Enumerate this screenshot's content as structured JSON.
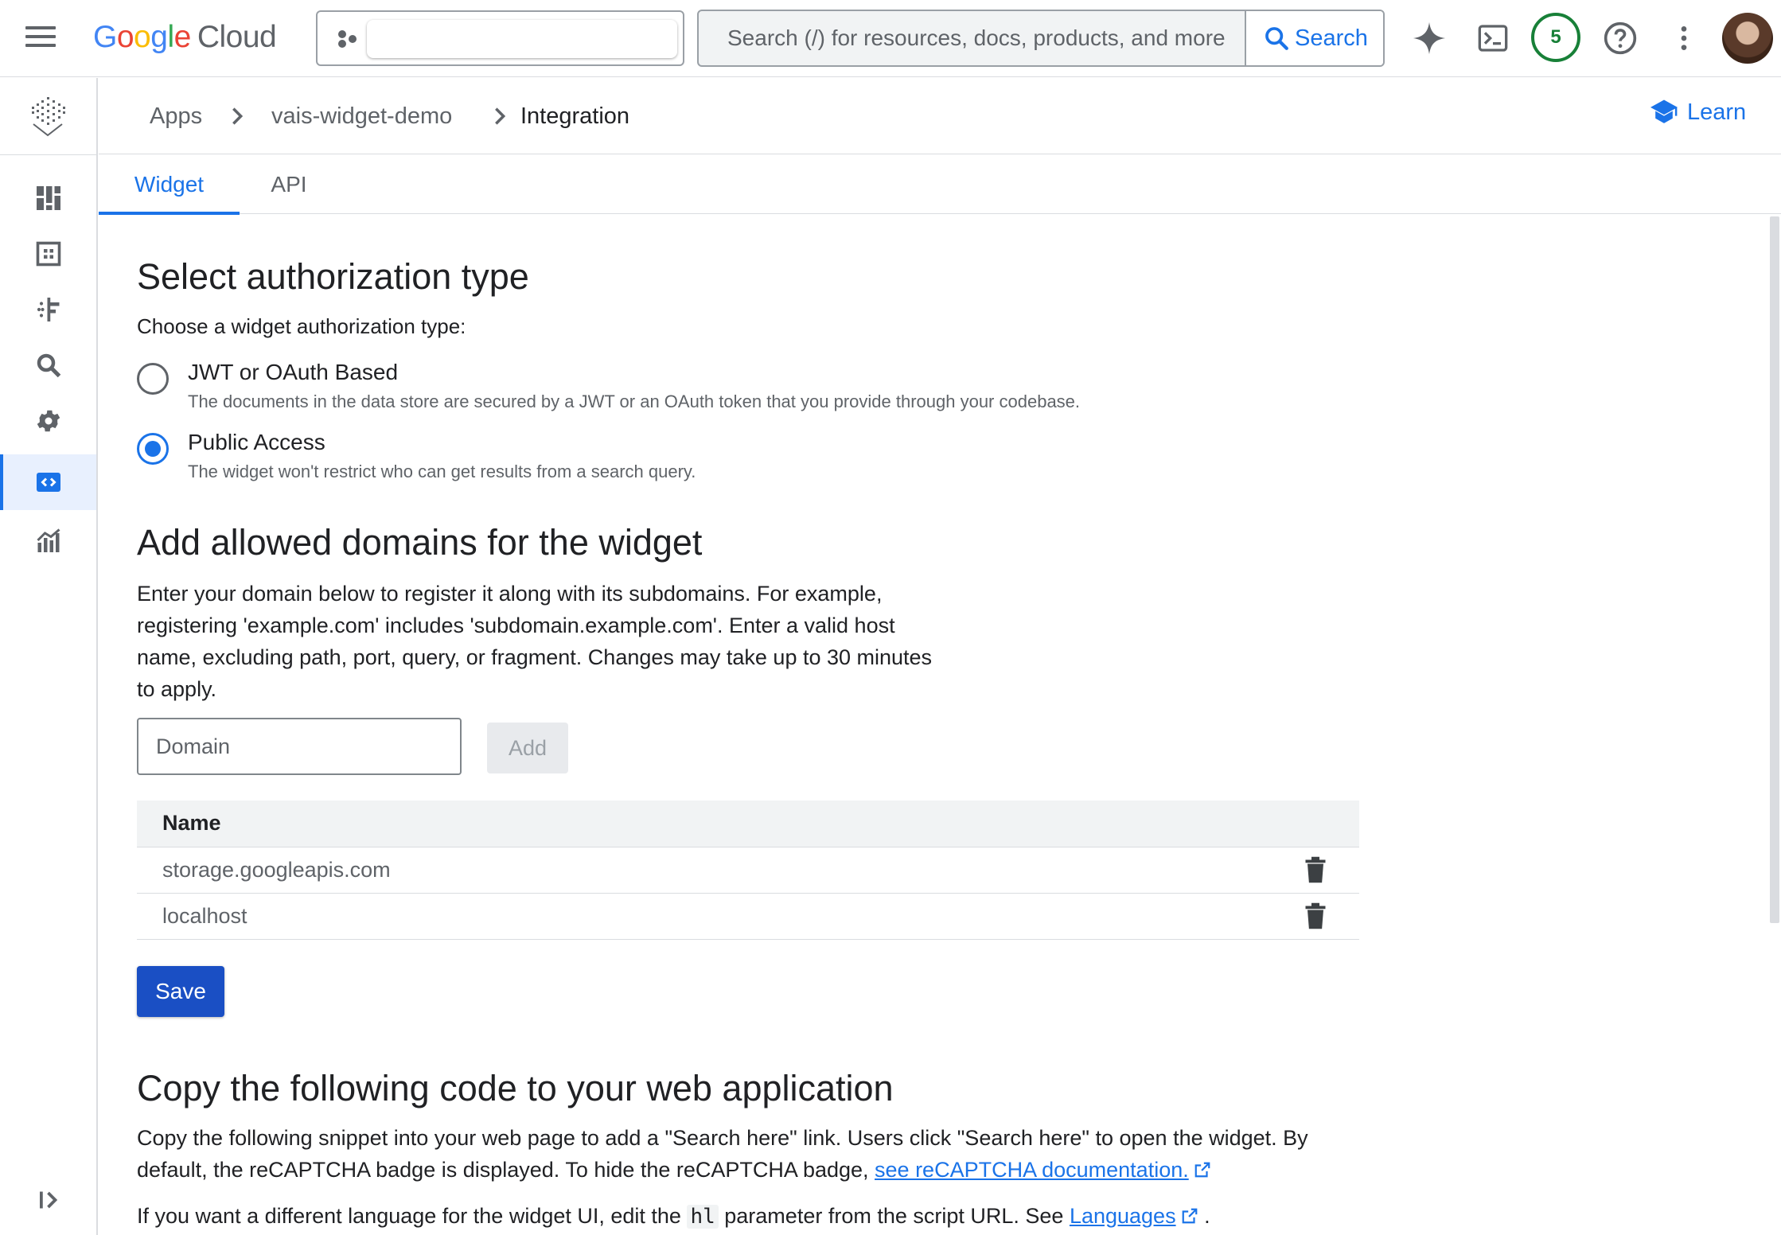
{
  "header": {
    "brand_google": [
      "G",
      "o",
      "o",
      "g",
      "l",
      "e"
    ],
    "brand_cloud": "Cloud",
    "search_placeholder": "Search (/) for resources, docs, products, and more",
    "search_button": "Search",
    "notifications_count": "5"
  },
  "breadcrumb": {
    "items": [
      "Apps",
      "vais-widget-demo",
      "Integration"
    ],
    "learn_label": "Learn"
  },
  "tabs": [
    "Widget",
    "API"
  ],
  "auth": {
    "title": "Select authorization type",
    "prompt": "Choose a widget authorization type:",
    "options": [
      {
        "label": "JWT or OAuth Based",
        "description": "The documents in the data store are secured by a JWT or an OAuth token that you provide through your codebase.",
        "selected": false
      },
      {
        "label": "Public Access",
        "description": "The widget won't restrict who can get results from a search query.",
        "selected": true
      }
    ]
  },
  "domains": {
    "title": "Add allowed domains for the widget",
    "description": "Enter your domain below to register it along with its subdomains. For example, registering 'example.com' includes 'subdomain.example.com'. Enter a valid host name, excluding path, port, query, or fragment. Changes may take up to 30 minutes to apply.",
    "input_placeholder": "Domain",
    "add_label": "Add",
    "column_name": "Name",
    "rows": [
      "storage.googleapis.com",
      "localhost"
    ],
    "save_label": "Save"
  },
  "code": {
    "title": "Copy the following code to your web application",
    "para1_text": "Copy the following snippet into your web page to add a \"Search here\" link. Users click \"Search here\" to open the widget. By default, the reCAPTCHA badge is displayed. To hide the reCAPTCHA badge, ",
    "para1_link": "see reCAPTCHA documentation.",
    "para2_pre": "If you want a different language for the widget UI, edit the ",
    "para2_code": "hl",
    "para2_mid": " parameter from the script URL. See ",
    "para2_link": "Languages",
    "para2_post": " ."
  },
  "colors": {
    "accent": "#1a73e8",
    "save_button": "#1a4fc4",
    "notification_badge": "#188038"
  },
  "icons": {
    "header": [
      "menu-icon",
      "resource-picker-icon",
      "search-icon",
      "gemini-sparkle-icon",
      "cloud-shell-icon",
      "help-icon",
      "more-vert-icon"
    ],
    "sidebar": [
      "dashboard-icon",
      "data-icon",
      "configurations-icon",
      "preview-search-icon",
      "settings-icon",
      "integration-icon",
      "analytics-icon",
      "expand-nav-icon"
    ]
  }
}
